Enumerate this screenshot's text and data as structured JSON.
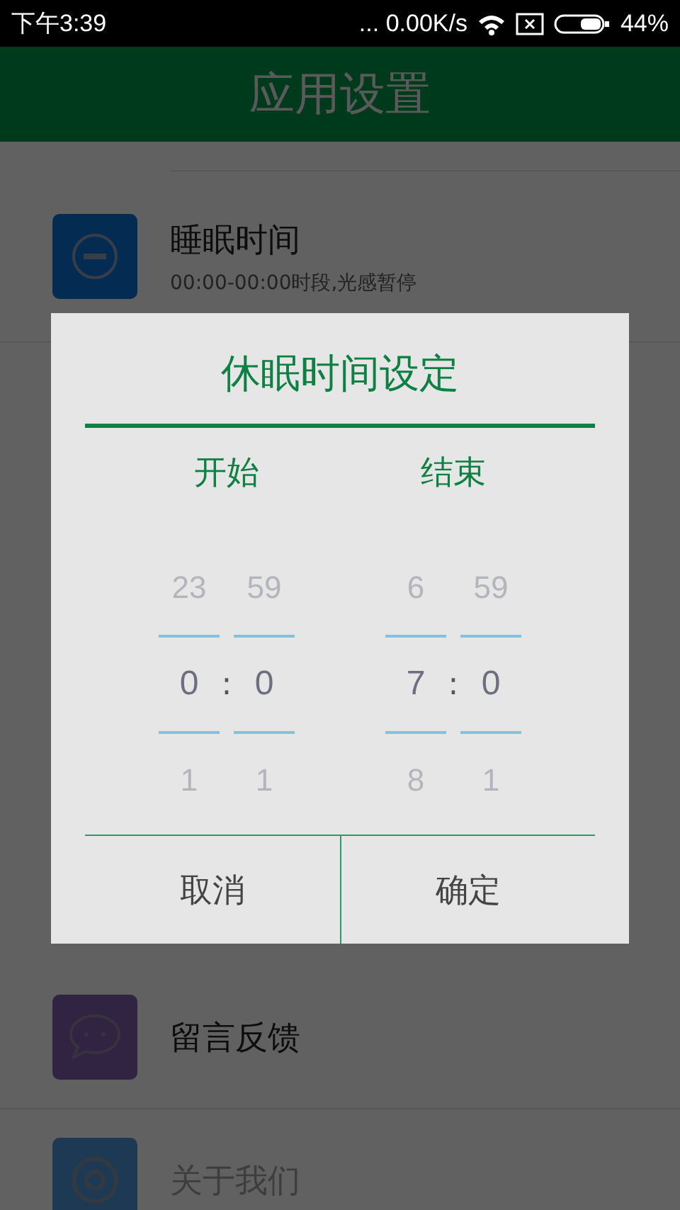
{
  "status_bar": {
    "time": "下午3:39",
    "network_speed": "... 0.00K/s",
    "battery": "44%"
  },
  "header": {
    "title": "应用设置"
  },
  "settings": [
    {
      "kind": "sleep",
      "title": "睡眠时间",
      "subtitle": "00:00-00:00时段,光感暂停"
    },
    {
      "kind": "feedback",
      "title": "留言反馈"
    },
    {
      "kind": "about",
      "title": "关于我们"
    }
  ],
  "dialog": {
    "title": "休眠时间设定",
    "pickers": [
      {
        "label": "开始",
        "separator": ":",
        "hour": {
          "prev": "23",
          "value": "0",
          "next": "1"
        },
        "minute": {
          "prev": "59",
          "value": "0",
          "next": "1"
        }
      },
      {
        "label": "结束",
        "separator": ":",
        "hour": {
          "prev": "6",
          "value": "7",
          "next": "8"
        },
        "minute": {
          "prev": "59",
          "value": "0",
          "next": "1"
        }
      }
    ],
    "buttons": [
      "取消",
      "确定"
    ]
  }
}
